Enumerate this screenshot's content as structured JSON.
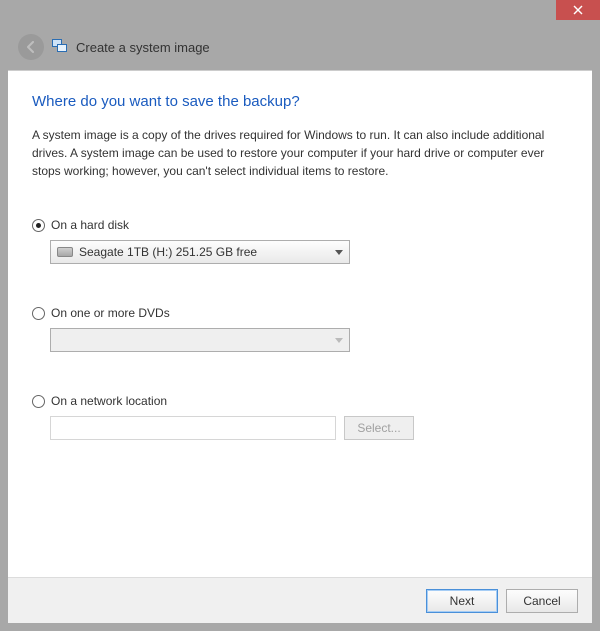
{
  "window": {
    "title": "Create a system image"
  },
  "page": {
    "heading": "Where do you want to save the backup?",
    "description": "A system image is a copy of the drives required for Windows to run. It can also include additional drives. A system image can be used to restore your computer if your hard drive or computer ever stops working; however, you can't select individual items to restore."
  },
  "options": {
    "hard_disk": {
      "label": "On a hard disk",
      "selected_drive": "Seagate 1TB (H:)  251.25 GB free"
    },
    "dvd": {
      "label": "On one or more DVDs",
      "selected": ""
    },
    "network": {
      "label": "On a network location",
      "path": "",
      "select_button": "Select..."
    }
  },
  "footer": {
    "next": "Next",
    "cancel": "Cancel"
  }
}
